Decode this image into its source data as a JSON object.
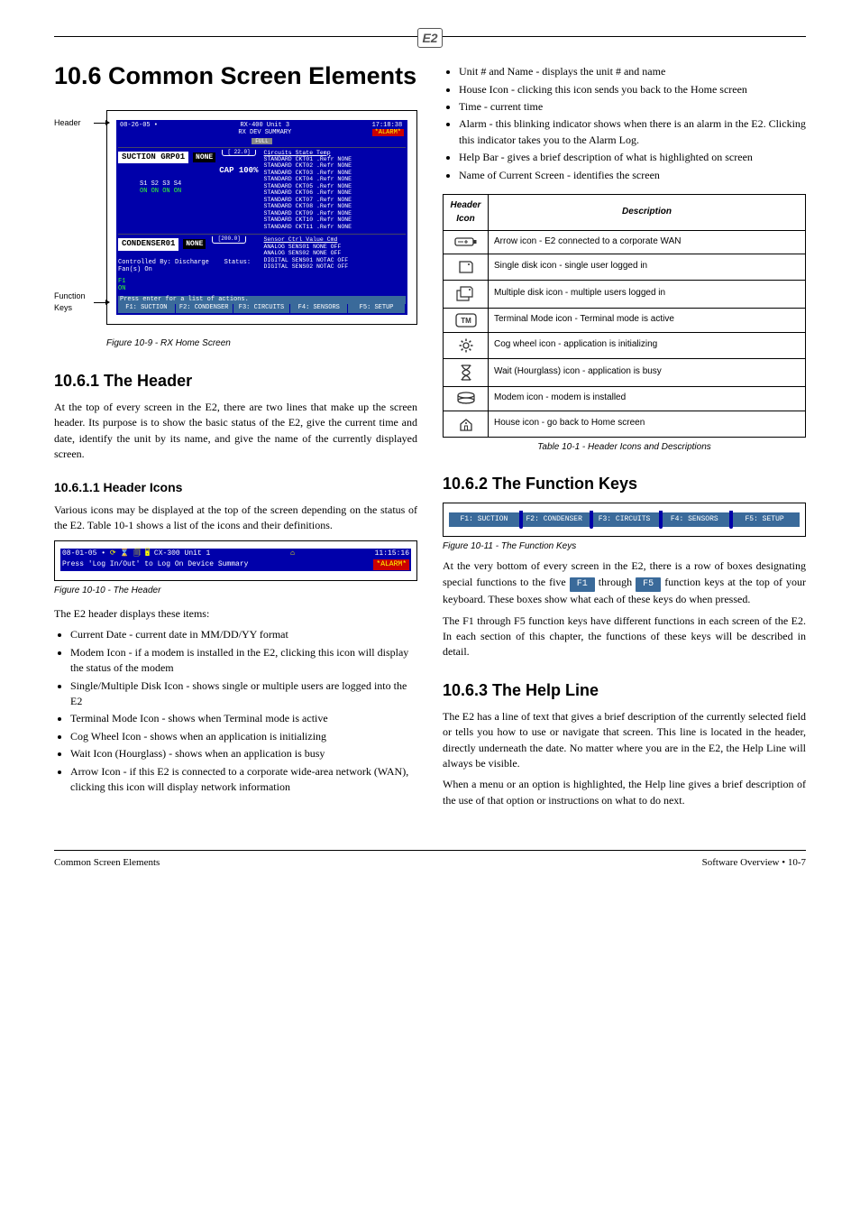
{
  "header_logo": "E2",
  "left": {
    "title": "10.6   Common Screen Elements",
    "fig1": {
      "arrows": {
        "header": "Header",
        "funcs": "Function Keys"
      },
      "top_left": "08-26-05 •",
      "top_center": "RX-400 Unit 3\nRX DEV SUMMARY",
      "top_time": "17:18:38",
      "top_alarm": "*ALARM*",
      "full_badge": "FULL",
      "suction": "SUCTION GRP01",
      "none1": "NONE",
      "sp1": "[ 22.0]",
      "cap": "CAP 100%",
      "stages_hdr": "S1   S2   S3   S4",
      "stages_val": "ON   ON   ON   ON",
      "circuits_hdr": "Circuits        State Temp",
      "circuits": [
        "STANDARD CKT01 .Refr NONE",
        "STANDARD CKT02 .Refr NONE",
        "STANDARD CKT03 .Refr NONE",
        "STANDARD CKT04 .Refr NONE",
        "STANDARD CKT05 .Refr NONE",
        "STANDARD CKT06 .Refr NONE",
        "STANDARD CKT07 .Refr NONE",
        "STANDARD CKT08 .Refr NONE",
        "STANDARD CKT09 .Refr NONE",
        "STANDARD CKT10 .Refr NONE",
        "STANDARD CKT11 .Refr NONE"
      ],
      "condenser": "CONDENSER01",
      "none2": "NONE",
      "sp2": "[200.0]",
      "ctrl_by": "Controlled By: Discharge",
      "status": "Status: Fan(s) On",
      "f1on": "F1\nON",
      "sensor_hdr": "Sensor Ctrl      Value  Cmd",
      "sensors": [
        "ANALOG SENS01   NONE   OFF",
        "ANALOG SENS02   NONE   OFF",
        "DIGITAL SENS01 NOTAC   OFF",
        "DIGITAL SENS02 NOTAC   OFF"
      ],
      "help_line": "Press enter for a list of actions.",
      "fkeys": [
        "F1: SUCTION",
        "F2: CONDENSER",
        "F3: CIRCUITS",
        "F4: SENSORS",
        "F5: SETUP"
      ],
      "caption": "Figure 10-9 - RX Home Screen"
    },
    "sub1_title": "10.6.1   The Header",
    "sub1_body": "At the top of every screen in the E2, there are two lines that make up the screen header. Its purpose is to show the basic status of the E2, give the current time and date, identify the unit by its name, and give the name of the currently displayed screen.",
    "sub2_title": "10.6.1.1   Header Icons",
    "sub2_body": "Various icons may be displayed at the top of the screen depending on the status of the E2. Table 10-1 shows a list of the icons and their definitions.",
    "fig2": {
      "left": "08-01-05 •",
      "icons_hint": "⟳ ⌛ 🗐   🖥",
      "center": "CX-300 Unit 1",
      "sub": "Press 'Log In/Out' to Log On        Device Summary",
      "corp": "⌂",
      "time": "11:15:16",
      "alarm": "*ALARM*",
      "caption": "Figure 10-10 - The Header"
    },
    "header_items_intro": "The E2 header displays these items:",
    "header_items": [
      "Current Date - current date in MM/DD/YY format",
      "Modem Icon - if a modem is installed in the E2, clicking this icon will display the status of the modem",
      "Single/Multiple Disk Icon - shows single or multiple users are logged into the E2",
      "Terminal Mode Icon - shows when Terminal mode is active",
      "Cog Wheel Icon - shows when an application is initializing",
      "Wait Icon (Hourglass) - shows when an application is busy",
      "Arrow Icon - if this E2 is connected to a corporate wide-area network (WAN), clicking this icon will display network information"
    ]
  },
  "right": {
    "header_items2": [
      "Unit # and Name - displays the unit # and name",
      "House Icon - clicking this icon sends you back to the Home screen",
      "Time - current time",
      "Alarm - this blinking indicator shows when there is an alarm in the E2. Clicking this indicator takes you to the Alarm Log.",
      "Help Bar - gives a brief description of what is highlighted on screen",
      "Name of Current Screen - identifies the screen"
    ],
    "table_caption": "Table 10-1 - Header Icons and Descriptions",
    "table_head": [
      "Header Icon",
      "Description"
    ],
    "table": [
      {
        "icon": "battery",
        "desc": "Arrow icon - E2 connected to a corporate WAN"
      },
      {
        "icon": "disk",
        "desc": "Single disk icon - single user logged in"
      },
      {
        "icon": "disks",
        "desc": "Multiple disk icon - multiple users logged in"
      },
      {
        "icon": "tm",
        "desc": "Terminal Mode icon - Terminal mode is active"
      },
      {
        "icon": "cog",
        "desc": "Cog wheel icon - application is initializing"
      },
      {
        "icon": "hourglass",
        "desc": "Wait (Hourglass) icon - application is busy"
      },
      {
        "icon": "modem",
        "desc": "Modem icon - modem is installed"
      },
      {
        "icon": "house",
        "desc": "House icon - go back to Home screen"
      }
    ],
    "sub3_title": "10.6.2   The Function Keys",
    "funcbar": {
      "keys": [
        "F1: SUCTION",
        "F2: CONDENSER",
        "F3: CIRCUITS",
        "F4: SENSORS",
        "F5: SETUP"
      ],
      "caption": "Figure 10-11 - The Function Keys"
    },
    "func_body1_a": "At the very bottom of every screen in the E2, there is a row of boxes designating special functions to the five ",
    "func_f1": "F1",
    "func_body1_b": " through ",
    "func_f5": "F5",
    "func_body1_c": " function keys at the top of your keyboard. These boxes show what each of these keys do when pressed.",
    "func_body2": "The F1 through F5 function keys have different functions in each screen of the E2. In each section of this chapter, the functions of these keys will be described in detail.",
    "sub4_title": "10.6.3   The Help Line",
    "help_body1": "The E2 has a line of text that gives a brief description of the currently selected field or tells you how to use or navigate that screen. This line is located in the header, directly underneath the date. No matter where you are in the E2, the Help Line will always be visible.",
    "help_body2": "When a menu or an option is highlighted, the Help line gives a brief description of the use of that option or instructions on what to do next."
  },
  "footer": {
    "left": "Common Screen Elements",
    "right": "Software Overview • 10-7"
  }
}
